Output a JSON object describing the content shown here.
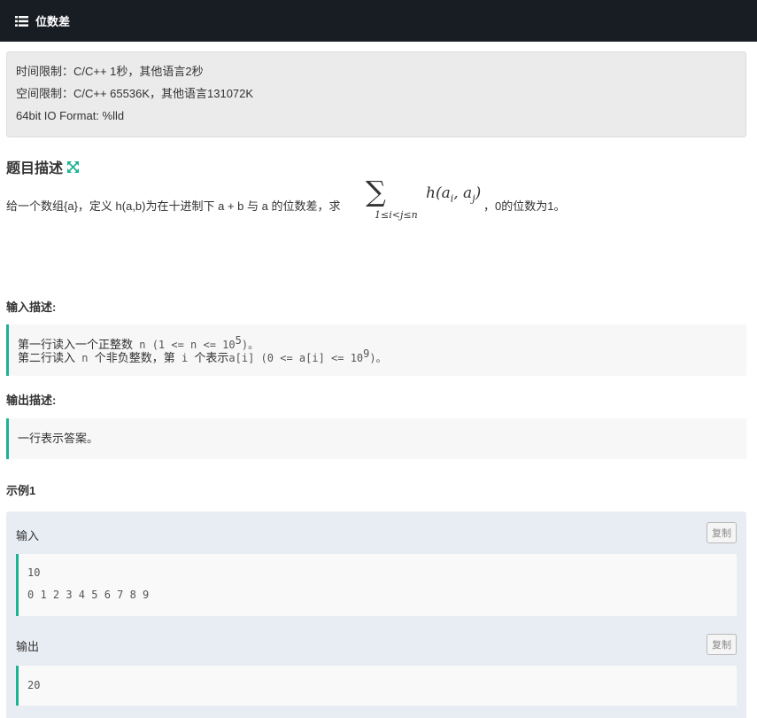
{
  "header": {
    "title": "位数差",
    "icon": "list-icon"
  },
  "limits": {
    "time": "时间限制：C/C++ 1秒，其他语言2秒",
    "space": "空间限制：C/C++ 65536K，其他语言131072K",
    "io_format": "64bit IO Format: %lld"
  },
  "description": {
    "title": "题目描述",
    "expand_icon": "expand-arrows-icon",
    "text_before": "给一个数组{a}，定义 h(a,b)为在十进制下 a + b 与 a 的位数差，求",
    "formula_sum_symbol": "∑",
    "formula_subscript": "1≤i<j≤n",
    "formula_body": "h(a",
    "formula_sub_i": "i",
    "formula_mid": ", a",
    "formula_sub_j": "j",
    "formula_end": ")",
    "text_after": "，0的位数为1。"
  },
  "input_section": {
    "title": "输入描述:",
    "line1_prefix": "第一行读入一个正整数",
    "line1_code": " n (1 <= n <= 10",
    "line1_sup": "5",
    "line1_close": ")。",
    "line2_prefix": "第二行读入",
    "line2_code1": " n ",
    "line2_mid": "个非负整数，第",
    "line2_code2": " i ",
    "line2_mid2": "个表示",
    "line2_code3": "a[i] (0 <= a[i] <= 10",
    "line2_sup": "9",
    "line2_close": ")。"
  },
  "output_section": {
    "title": "输出描述:",
    "text": "一行表示答案。"
  },
  "example": {
    "title": "示例1",
    "input_label": "输入",
    "output_label": "输出",
    "copy_label": "复制",
    "input_lines": [
      "10",
      "0 1 2 3 4 5 6 7 8 9"
    ],
    "output_lines": [
      "20"
    ]
  },
  "colors": {
    "accent": "#1cb394",
    "topbar": "#171d22"
  }
}
